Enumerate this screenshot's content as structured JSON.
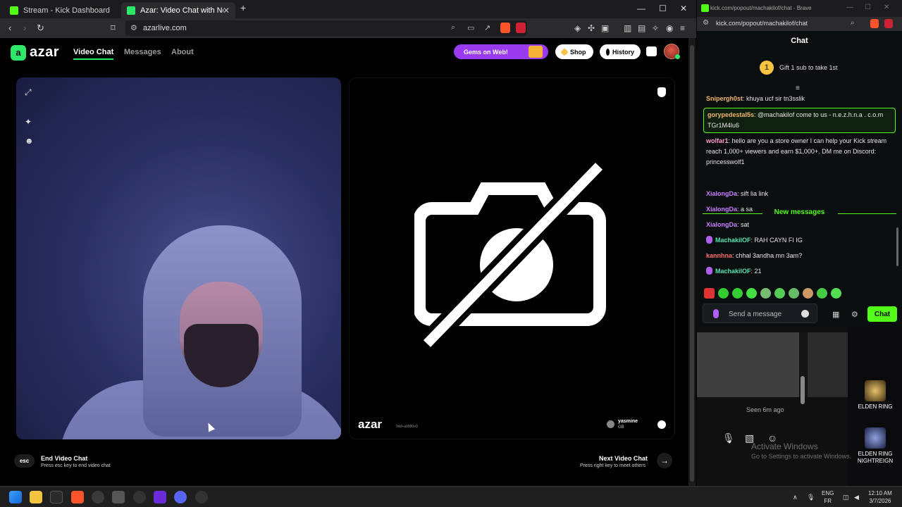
{
  "left_window": {
    "tabs": [
      {
        "label": "Stream - Kick Dashboard"
      },
      {
        "label": "Azar: Video Chat with New Pe"
      }
    ],
    "url": "azarlive.com",
    "add_tab_symbol": "+",
    "close_tab_symbol": "✕"
  },
  "azar": {
    "logo_text": "azar",
    "nav": [
      "Video Chat",
      "Messages",
      "About"
    ],
    "gems_label": "Gems on Web!",
    "shop_label": "Shop",
    "history_label": "History",
    "watermark": "azar",
    "watermark_sub": "9dd+a0880e3",
    "peer_name": "yasmine",
    "peer_country": "GB",
    "esc_key": "esc",
    "end_title": "End Video Chat",
    "end_sub": "Press esc key to end video chat",
    "next_title": "Next Video Chat",
    "next_sub": "Press right key to meet others"
  },
  "right_window": {
    "title": "kick.com/popout/machakilof/chat - Brave",
    "url": "kick.com/popout/machakilof/chat",
    "chat_header": "Chat",
    "gift_rank": "1",
    "gift_text": "Gift 1 sub to take 1st",
    "messages": [
      {
        "user": "Snipergh0st",
        "color": "#f2b56b",
        "text": "khuya ucf sir tn3sslik",
        "mic": false
      },
      {
        "user": "gorypedestal5s",
        "color": "#f2b56b",
        "text": "@machakilof come to us - n.e.z.h.n.a . c.o.m TGr1M4lu6",
        "mic": false
      },
      {
        "user": "wolfar1",
        "color": "#ff9ad1",
        "text": "hello are you a store owner I can help your Kick stream reach 1,000+ viewers and earn $1,000+. DM me on Discord: princesswolf1",
        "mic": false
      },
      {
        "user": "XialongDa",
        "color": "#c77dff",
        "text": "sift lia link",
        "mic": false
      },
      {
        "user": "XialongDa",
        "color": "#c77dff",
        "text": "a sa",
        "mic": false
      },
      {
        "user": "XialongDa",
        "color": "#c77dff",
        "text": "sat",
        "mic": false
      },
      {
        "user": "MachakilOF",
        "color": "#53e6b5",
        "text": "RAH CAYN FI IG",
        "mic": true
      },
      {
        "user": "kannhna",
        "color": "#ff6b6b",
        "text": "chhal 3andha mn 3am?",
        "mic": false
      },
      {
        "user": "MachakilOF",
        "color": "#53e6b5",
        "text": "21",
        "mic": true
      }
    ],
    "new_messages_label": "New messages",
    "send_placeholder": "Send a message",
    "chat_button": "Chat"
  },
  "back_window": {
    "seen_text": "Seen 6m ago"
  },
  "desktop": {
    "watermark_title": "Activate Windows",
    "watermark_sub": "Go to Settings to activate Windows.",
    "icons": [
      "ELDEN RING",
      "ELDEN RING NIGHTREIGN"
    ]
  },
  "taskbar": {
    "lang_1": "ENG",
    "lang_2": "FR",
    "time": "12:10 AM",
    "date": "3/7/2026"
  },
  "colors": {
    "azar_green": "#2ee86a",
    "kick_green": "#53fc18",
    "gems_purple": "#9b3bf0"
  }
}
